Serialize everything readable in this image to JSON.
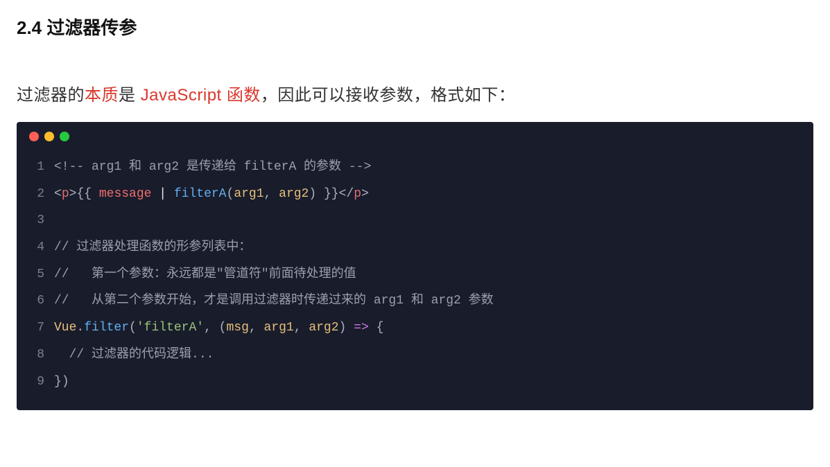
{
  "heading": "2.4 过滤器传参",
  "intro": {
    "p1": "过滤器的",
    "strong1": "本质",
    "p2": "是 ",
    "strong2": "JavaScript 函数",
    "p3": "，因此可以接收参数，格式如下：",
    "red": "#d9372c"
  },
  "code": {
    "bg": "#191c2b",
    "dots": {
      "red": "#ff5f56",
      "yellow": "#ffbd2e",
      "green": "#27c93f"
    },
    "lines": {
      "l1": {
        "no": "1",
        "c1": "<!-- arg1 和 arg2 是传递给 filterA 的参数 -->"
      },
      "l2": {
        "no": "2",
        "t_open_b": "<",
        "t_open_n": "p",
        "t_open_c": ">",
        "must_o": "{{ ",
        "msg": "message",
        "pipe": " | ",
        "fn": "filterA",
        "paren_o": "(",
        "arg1": "arg1",
        "comma": ", ",
        "arg2": "arg2",
        "paren_c": ")",
        "must_c": " }}",
        "t_close_b": "</",
        "t_close_n": "p",
        "t_close_c": ">"
      },
      "l3": {
        "no": "3"
      },
      "l4": {
        "no": "4",
        "c": "// 过滤器处理函数的形参列表中："
      },
      "l5": {
        "no": "5",
        "c": "//   第一个参数：永远都是\"管道符\"前面待处理的值"
      },
      "l6": {
        "no": "6",
        "c": "//   从第二个参数开始，才是调用过滤器时传递过来的 arg1 和 arg2 参数"
      },
      "l7": {
        "no": "7",
        "obj": "Vue",
        "dot": ".",
        "method": "filter",
        "paren_o": "(",
        "str": "'filterA'",
        "comma1": ", ",
        "paren2_o": "(",
        "p_msg": "msg",
        "cm2": ", ",
        "p_a1": "arg1",
        "cm3": ", ",
        "p_a2": "arg2",
        "paren2_c": ")",
        "arrow": " => ",
        "brace_o": "{"
      },
      "l8": {
        "no": "8",
        "indent": "  ",
        "c": "// 过滤器的代码逻辑..."
      },
      "l9": {
        "no": "9",
        "brace_c": "}",
        "paren_c": ")"
      }
    }
  }
}
